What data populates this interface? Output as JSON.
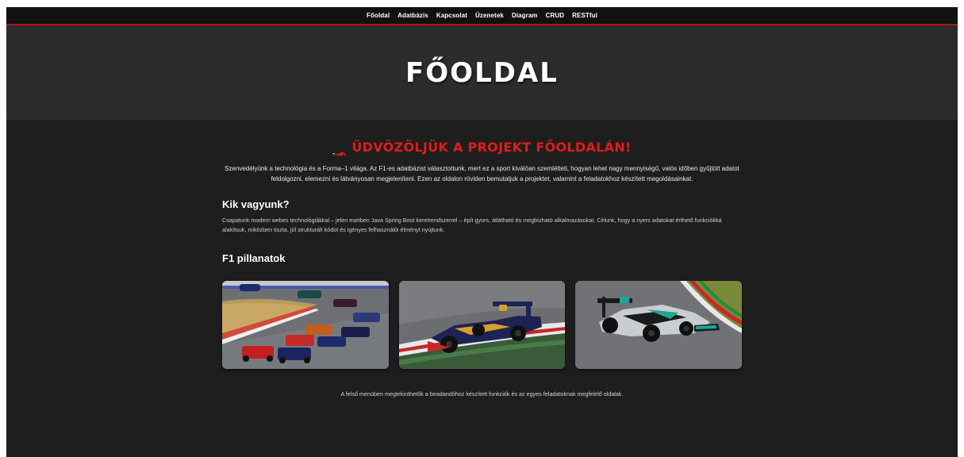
{
  "nav": {
    "items": [
      {
        "label": "Főoldal"
      },
      {
        "label": "Adatbázis"
      },
      {
        "label": "Kapcsolat"
      },
      {
        "label": "Üzenetek"
      },
      {
        "label": "Diagram"
      },
      {
        "label": "CRUD"
      },
      {
        "label": "RESTful"
      }
    ]
  },
  "hero": {
    "title": "FŐOLDAL"
  },
  "welcome": {
    "heading": "ÜDVÖZÖLJÜK A PROJEKT FŐOLDALÁN!",
    "icon": "race-car-icon",
    "intro": "Szenvedélyünk a technológia és a Forma–1 világa. Az F1-es adatbázist választottunk, mert ez a sport kiválóan szemlélteti, hogyan lehet nagy mennyiségű, valós időben gyűjtött adatot feldolgozni, elemezni és látványosan megjeleníteni. Ezen az oldalon röviden bemutatjuk a projektet, valamint a feladatokhoz készített megoldásainkat."
  },
  "about": {
    "title": "Kik vagyunk?",
    "text": "Csapatunk modern webes technológiákkal – jelen esetben Java Spring Boot keretrendszerrel – épít gyors, átlátható és megbízható alkalmazásokat. Célunk, hogy a nyers adatokat érthető funkciókká alakítsuk, miközben tiszta, jól strukturált kódot és igényes felhasználói élményt nyújtunk."
  },
  "moments": {
    "title": "F1 pillanatok",
    "photos": [
      {
        "name": "race-start-photo"
      },
      {
        "name": "red-bull-car-photo"
      },
      {
        "name": "mercedes-car-photo"
      }
    ]
  },
  "footer": {
    "note": "A felső menüben megtekinthetők a beadandóhoz készített funkciók és az egyes feladatoknak megfelelő oldalak."
  },
  "colors": {
    "accent": "#e21b1b",
    "nav_border": "#b0141a",
    "background": "#1e1e1e",
    "hero_background": "#2c2c2c"
  }
}
